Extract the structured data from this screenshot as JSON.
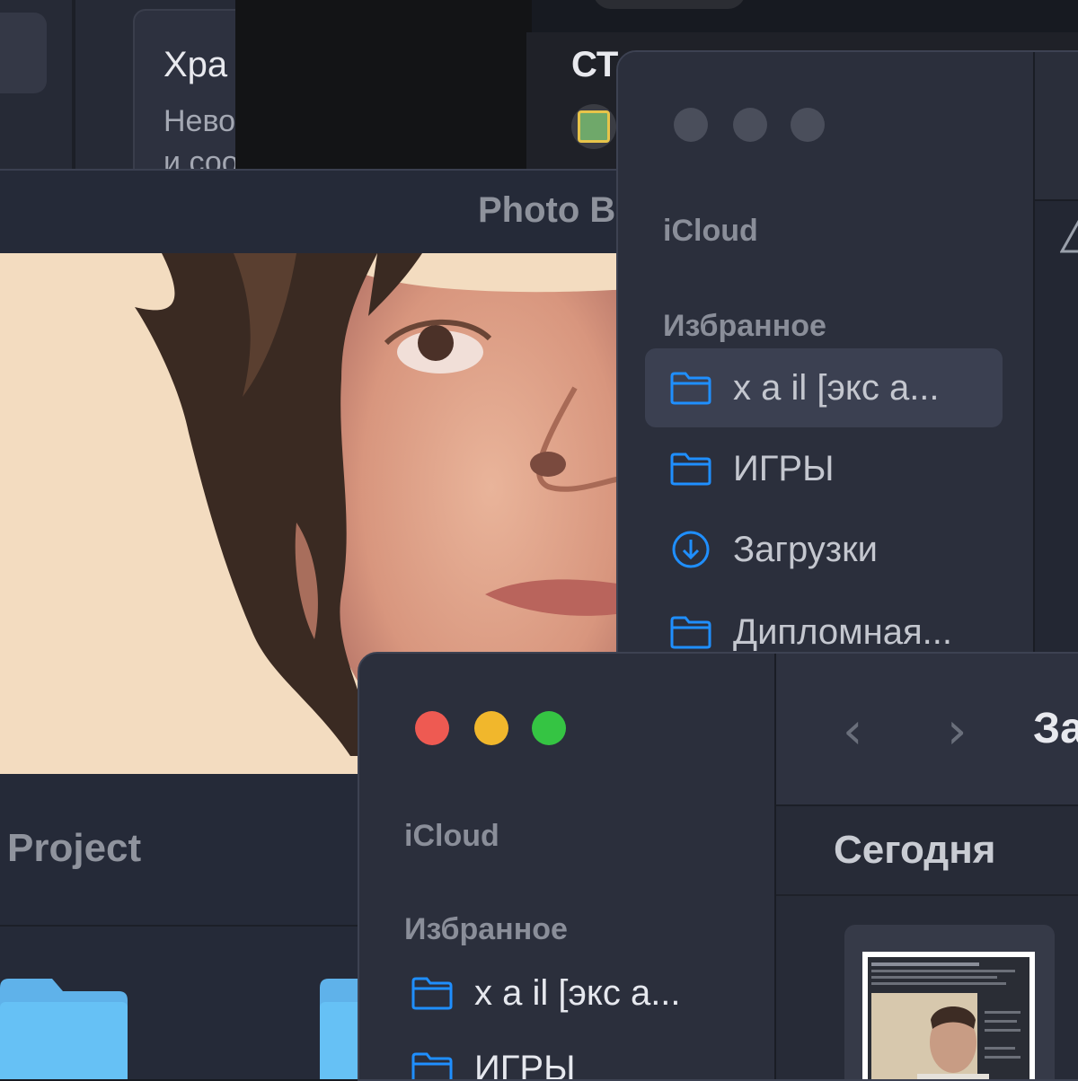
{
  "background": {
    "card": {
      "title": "Хра",
      "line1": "Нево",
      "line2": "и соо"
    },
    "right_header": "СТ"
  },
  "photo_window": {
    "title": "Photo B",
    "section_label": "Project"
  },
  "finder_back": {
    "icloud_label": "iCloud",
    "favorites_label": "Избранное",
    "items": [
      {
        "label": "x a il [экс а...",
        "icon": "folder-icon",
        "selected": true
      },
      {
        "label": "ИГРЫ",
        "icon": "folder-icon",
        "selected": false
      },
      {
        "label": "Загрузки",
        "icon": "download-icon",
        "selected": false
      },
      {
        "label": "Дипломная...",
        "icon": "folder-icon",
        "selected": false
      }
    ]
  },
  "finder_front": {
    "icloud_label": "iCloud",
    "favorites_label": "Избранное",
    "items": [
      {
        "label": "x a il [экс а...",
        "icon": "folder-icon"
      },
      {
        "label": "ИГРЫ",
        "icon": "folder-icon"
      }
    ],
    "toolbar": {
      "back": "‹",
      "forward": "›",
      "title": "За"
    },
    "group_header": "Сегодня"
  },
  "colors": {
    "accent_blue": "#1f8fff",
    "traffic_red": "#ee5a52",
    "traffic_yellow": "#f1b72c",
    "traffic_green": "#35c443",
    "traffic_inactive": "#4a4e5b"
  }
}
